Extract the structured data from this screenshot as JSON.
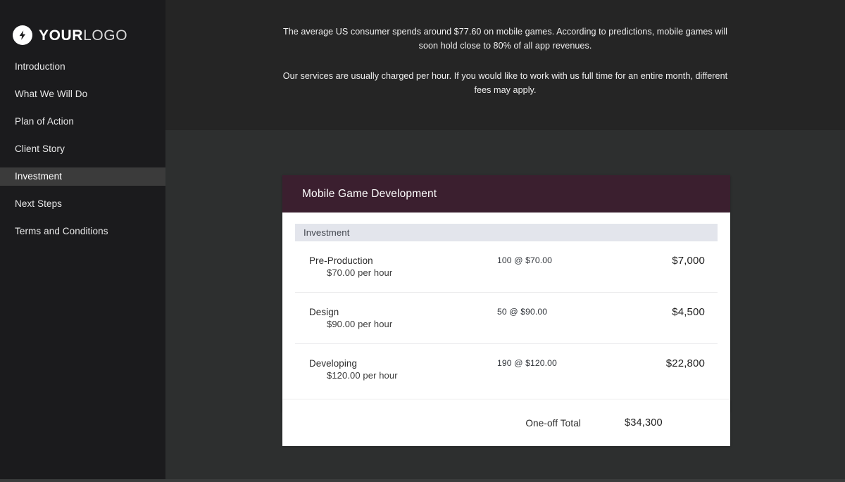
{
  "sidebar": {
    "logo": {
      "icon": "lightning-bolt-icon",
      "bold_text": "YOUR",
      "light_text": "LOGO"
    },
    "items": [
      {
        "label": "Introduction",
        "active": false
      },
      {
        "label": "What We Will Do",
        "active": false
      },
      {
        "label": "Plan of Action",
        "active": false
      },
      {
        "label": "Client Story",
        "active": false
      },
      {
        "label": "Investment",
        "active": true
      },
      {
        "label": "Next Steps",
        "active": false
      },
      {
        "label": "Terms and Conditions",
        "active": false
      }
    ]
  },
  "intro": {
    "paragraph_1": "The average US consumer spends around $77.60 on mobile games. According to predictions, mobile games will soon hold close to 80% of all app revenues.",
    "paragraph_2": "Our services are usually charged per hour. If you would like to work with us full time for an entire month, different fees may apply."
  },
  "price_card": {
    "header_title": "Mobile Game Development",
    "section_label": "Investment",
    "items": [
      {
        "name": "Pre-Production",
        "rate": "$70.00 per hour",
        "quantity": "100 @ $70.00",
        "amount": "$7,000"
      },
      {
        "name": "Design",
        "rate": "$90.00 per hour",
        "quantity": "50 @ $90.00",
        "amount": "$4,500"
      },
      {
        "name": "Developing",
        "rate": "$120.00 per hour",
        "quantity": "190 @ $120.00",
        "amount": "$22,800"
      }
    ]
  },
  "total_card": {
    "label": "One-off Total",
    "amount": "$34,300"
  },
  "colors": {
    "sidebar_bg": "#1b1b1d",
    "sidebar_active": "#3b3b3b",
    "intro_bg": "#252525",
    "page_bg": "#2d2f2f",
    "card_header": "#3b1f2f",
    "section_band": "#e3e5ec",
    "card_bg": "#ffffff"
  }
}
